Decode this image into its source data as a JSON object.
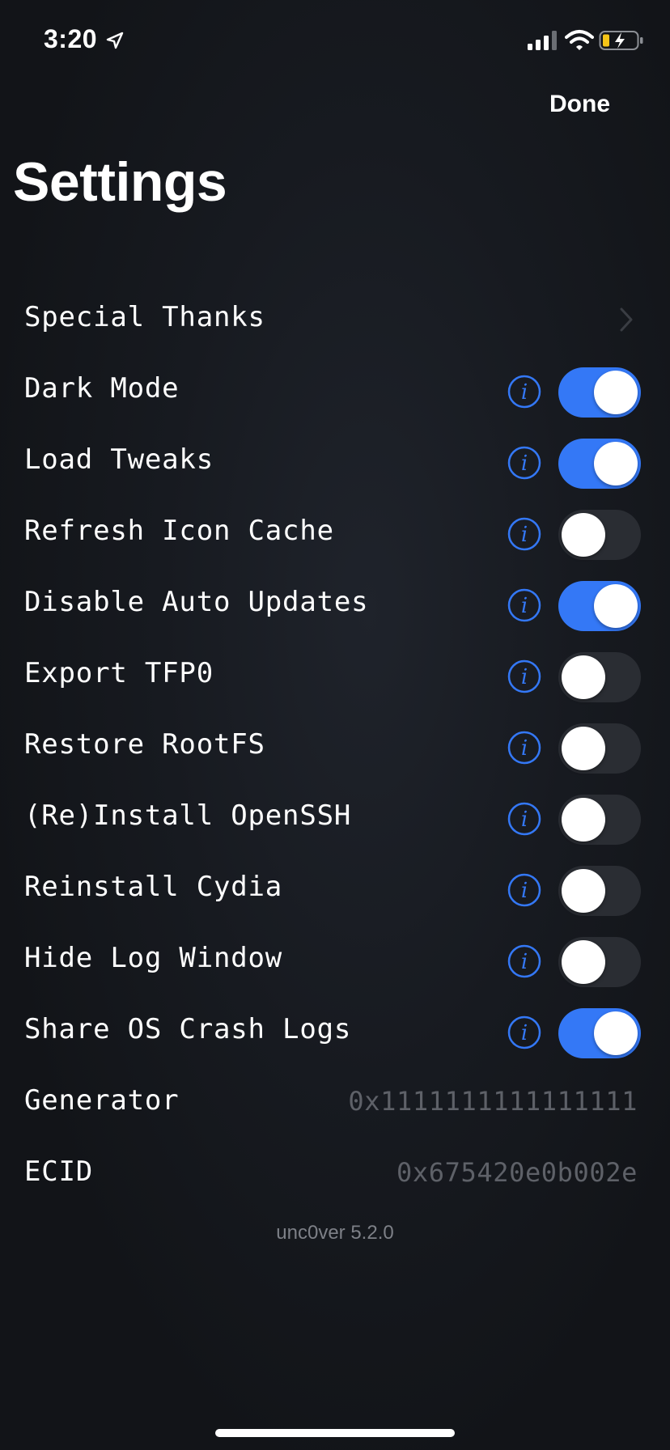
{
  "status_bar": {
    "time": "3:20",
    "icons": [
      "location-icon",
      "signal-icon",
      "wifi-icon",
      "battery-charging-icon"
    ]
  },
  "nav": {
    "done_label": "Done",
    "title": "Settings"
  },
  "colors": {
    "accent": "#3478f6",
    "background": "#121418",
    "toggle_off": "#2a2d33",
    "value_text": "#5e6168"
  },
  "rows": [
    {
      "label": "Special Thanks",
      "type": "link"
    },
    {
      "label": "Dark Mode",
      "type": "toggle",
      "on": true
    },
    {
      "label": "Load Tweaks",
      "type": "toggle",
      "on": true
    },
    {
      "label": "Refresh Icon Cache",
      "type": "toggle",
      "on": false
    },
    {
      "label": "Disable Auto Updates",
      "type": "toggle",
      "on": true
    },
    {
      "label": "Export TFP0",
      "type": "toggle",
      "on": false
    },
    {
      "label": "Restore RootFS",
      "type": "toggle",
      "on": false
    },
    {
      "label": "(Re)Install OpenSSH",
      "type": "toggle",
      "on": false
    },
    {
      "label": "Reinstall Cydia",
      "type": "toggle",
      "on": false
    },
    {
      "label": "Hide Log Window",
      "type": "toggle",
      "on": false
    },
    {
      "label": "Share OS Crash Logs",
      "type": "toggle",
      "on": true
    },
    {
      "label": "Generator",
      "type": "value",
      "value": "0x1111111111111111"
    },
    {
      "label": "ECID",
      "type": "value",
      "value": "0x675420e0b002e"
    }
  ],
  "footer": {
    "version": "unc0ver 5.2.0"
  }
}
